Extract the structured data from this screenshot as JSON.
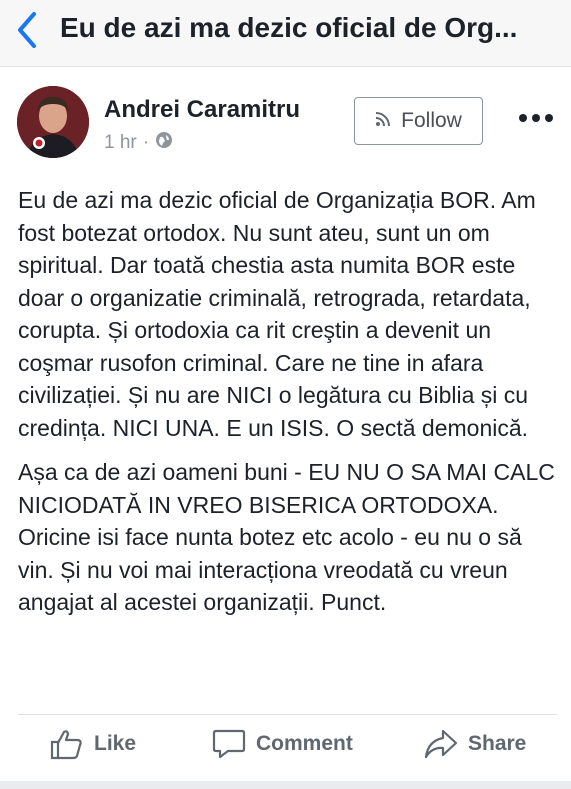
{
  "header": {
    "title": "Eu de azi ma dezic oficial de Org..."
  },
  "post": {
    "author": "Andrei Caramitru",
    "time": "1 hr",
    "separator": "·",
    "follow_label": "Follow",
    "avatar_badge": "STOP COVID-19",
    "paragraphs": [
      "Eu de azi ma dezic oficial de Organizația BOR. Am fost botezat ortodox. Nu sunt ateu, sunt un om spiritual. Dar toată chestia asta numita BOR este doar o organizatie criminală, retrograda, retardata, corupta. Și ortodoxia ca rit creştin a devenit un coşmar rusofon criminal. Care ne tine in afara civilizației. Și nu are NICI o legătura cu Biblia și cu credința. NICI UNA. E un ISIS. O sectă demonică.",
      "Așa ca de azi oameni buni - EU NU O SA MAI CALC NICIODATĂ IN VREO BISERICA ORTODOXA. Oricine isi face nunta botez etc acolo - eu nu o să vin. Și nu voi mai interacționa vreodată cu vreun angajat al acestei organizații. Punct."
    ]
  },
  "actions": {
    "like": "Like",
    "comment": "Comment",
    "share": "Share"
  },
  "colors": {
    "accent": "#1877f2",
    "text": "#1d2129",
    "muted": "#90949c",
    "action": "#606770"
  },
  "icons": [
    "back-chevron-icon",
    "globe-icon",
    "rss-icon",
    "more-icon",
    "like-icon",
    "comment-icon",
    "share-icon"
  ]
}
